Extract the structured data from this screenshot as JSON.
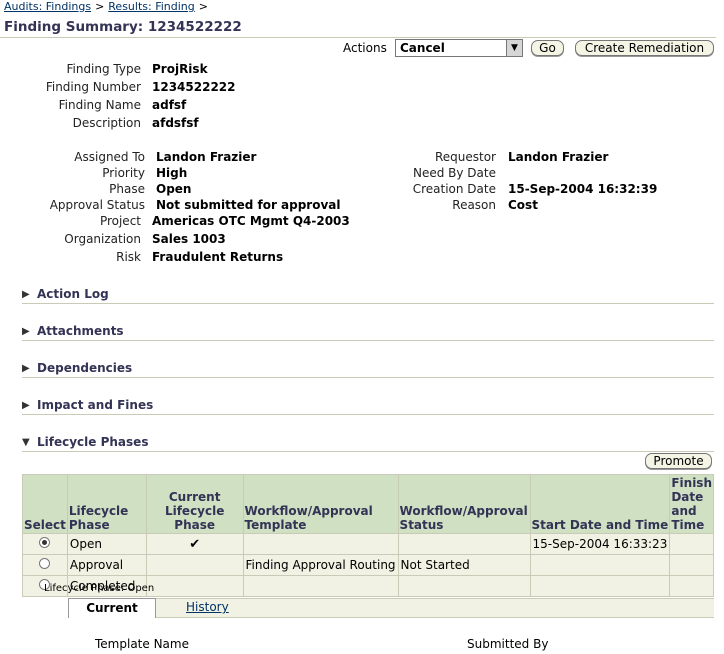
{
  "breadcrumb": {
    "item1": "Audits: Findings",
    "item2": "Results: Finding",
    "sep": ">"
  },
  "page_title": "Finding Summary: 1234522222",
  "actions": {
    "label": "Actions",
    "selected": "Cancel",
    "go": "Go",
    "create": "Create Remediation"
  },
  "fields": {
    "finding_type": {
      "label": "Finding Type",
      "value": "ProjRisk"
    },
    "finding_number": {
      "label": "Finding Number",
      "value": "1234522222"
    },
    "finding_name": {
      "label": "Finding Name",
      "value": "adfsf"
    },
    "description": {
      "label": "Description",
      "value": "afdsfsf"
    },
    "assigned_to": {
      "label": "Assigned To",
      "value": "Landon Frazier"
    },
    "priority": {
      "label": "Priority",
      "value": "High"
    },
    "phase": {
      "label": "Phase",
      "value": "Open"
    },
    "approval_status": {
      "label": "Approval Status",
      "value": "Not submitted for approval"
    },
    "project": {
      "label": "Project",
      "value": "Americas OTC Mgmt Q4-2003"
    },
    "organization": {
      "label": "Organization",
      "value": "Sales 1003"
    },
    "risk": {
      "label": "Risk",
      "value": "Fraudulent Returns"
    },
    "requestor": {
      "label": "Requestor",
      "value": "Landon Frazier"
    },
    "need_by_date": {
      "label": "Need By Date",
      "value": ""
    },
    "creation_date": {
      "label": "Creation Date",
      "value": "15-Sep-2004 16:32:39"
    },
    "reason": {
      "label": "Reason",
      "value": "Cost"
    }
  },
  "sections": {
    "action_log": "Action Log",
    "attachments": "Attachments",
    "dependencies": "Dependencies",
    "impact": "Impact and Fines",
    "lifecycle": "Lifecycle Phases"
  },
  "promote": "Promote",
  "table": {
    "headers": [
      "Select",
      "Lifecycle Phase",
      "Current Lifecycle Phase",
      "Workflow/Approval Template",
      "Workflow/Approval Status",
      "Start Date and Time",
      "Finish Date and Time"
    ],
    "rows": [
      {
        "phase": "Open",
        "current": "✔",
        "template": "",
        "status": "",
        "start": "15-Sep-2004 16:33:23",
        "finish": ""
      },
      {
        "phase": "Approval",
        "current": "",
        "template": "Finding Approval Routing",
        "status": "Not Started",
        "start": "",
        "finish": ""
      },
      {
        "phase": "Completed",
        "current": "",
        "template": "",
        "status": "",
        "start": "",
        "finish": ""
      }
    ]
  },
  "phase_caption": "Lifecycle Phase: Open",
  "tabs": {
    "current": "Current",
    "history": "History"
  },
  "bottom": {
    "template_name": "Template Name",
    "submitted_by": "Submitted By"
  }
}
